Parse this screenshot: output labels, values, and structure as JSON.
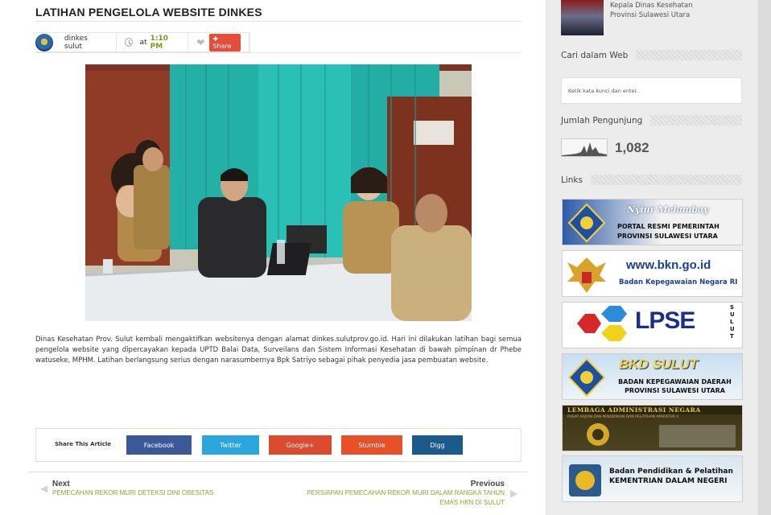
{
  "article": {
    "title": "LATIHAN PENGELOLA WEBSITE DINKES",
    "author": "dinkes sulut",
    "time_prefix": "at",
    "time": "1:10 PM",
    "share_label": "Share",
    "body": "Dinas Kesehatan Prov.  Sulut kembali mengaktifkan  websitenya dengan alamat dinkes.sulutprov.go.id. Hari ini dilakukan latihan bagi semua pengelola website yang dipercayakan kepada UPTD Balai Data, Surveilans dan Sistem Informasi Kesehatan di bawah pimpinan dr Phebe watuseke, MPHM. Latihan berlangsung serius dengan narasumbernya Bpk Satriyo sebagai pihak penyedia jasa pembuatan website."
  },
  "share_bar": {
    "label": "Share This Article",
    "buttons": [
      {
        "label": "Facebook",
        "color": "#3b5998"
      },
      {
        "label": "Twitter",
        "color": "#2aa7dd"
      },
      {
        "label": "Google+",
        "color": "#dc4a30"
      },
      {
        "label": "Stumble",
        "color": "#e8502a"
      },
      {
        "label": "Digg",
        "color": "#1c5a8e"
      }
    ]
  },
  "post_nav": {
    "next_heading": "Next",
    "next_title": "PEMECAHAN REKOR MURI DETEKSI DINI OBESITAS",
    "previous_heading": "Previous",
    "previous_title_1": "PERSIAPAN PEMECAHAN REKOR MURI DALAM RANGKA TAHUN",
    "previous_title_2": "EMAS HKN DI SULUT"
  },
  "sidebar": {
    "top_post_line1": "Kepala Dinas Kesehatan",
    "top_post_line2": "Provinsi Sulawesi Utara",
    "search_heading": "Cari dalam Web",
    "search_placeholder": "Ketik kata kunci dan enter..",
    "visitors_heading": "Jumlah Pengunjung",
    "visitors_count": "1,082",
    "links_heading": "Links",
    "banners": [
      {
        "line1": "Nyiur Melambay",
        "line2": "PORTAL RESMI PEMERINTAH",
        "line3": "PROVINSI SULAWESI UTARA"
      },
      {
        "line1": "www.bkn.go.id",
        "line2": "Badan Kepegawaian Negara RI"
      },
      {
        "line1": "LPSE",
        "line2": "SULUT"
      },
      {
        "line1": "BKD SULUT",
        "line2": "BADAN KEPEGAWAIAN DAERAH",
        "line3": "PROVINSI SULAWESI UTARA"
      },
      {
        "line1": "LEMBAGA ADMINISTRASI NEGARA",
        "line2": "PUSAT KAJIAN DAN PENDIDIKAN DAN PELATIHAN APARATUR II"
      },
      {
        "line1": "Badan Pendidikan & Pelatihan",
        "line2": "KEMENTRIAN DALAM NEGERI"
      }
    ]
  }
}
